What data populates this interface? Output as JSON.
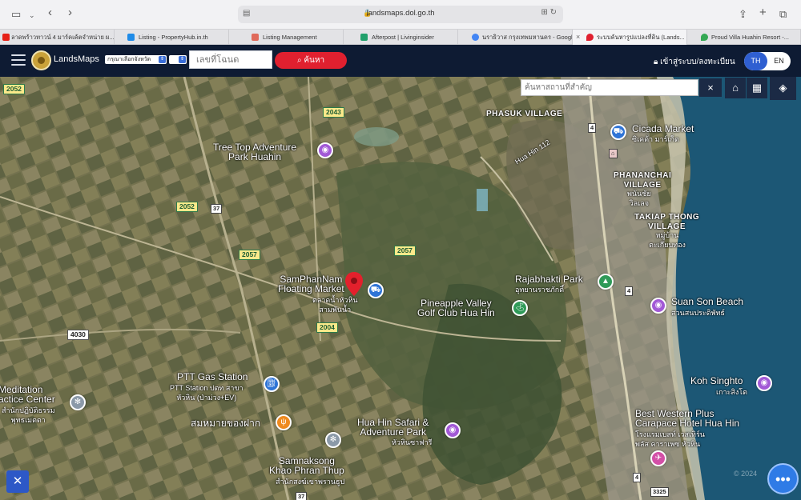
{
  "browser": {
    "url": "landsmaps.dol.go.th",
    "tabs": [
      {
        "label": "ลาดพร้าวทาวน์ 4 มาร์คเค้ตจำหน่าย ผ...",
        "color": "#e62117"
      },
      {
        "label": "Listing - PropertyHub.in.th",
        "color": "#1e8be8"
      },
      {
        "label": "Listing Management",
        "color": "#e06a5a"
      },
      {
        "label": "Afterpost | Livinginsider",
        "color": "#21a06b"
      },
      {
        "label": "นราธิวาส กรุงเทพมหานคร - Google...",
        "color": "#4285f4"
      },
      {
        "label": "ระบบค้นหารูปแปลงที่ดิน (Lands...",
        "color": "#e0202f"
      },
      {
        "label": "Proud Villa Huahin Resort -...",
        "color": "#34a853"
      }
    ]
  },
  "header": {
    "brand": "LandsMaps",
    "province_select": "กรุณาเลือกจังหวัด",
    "deed_placeholder": "เลขที่โฉนด",
    "search_label": "ค้นหา",
    "login_label": "เข้าสู่ระบบ/ลงทะเบียน",
    "lang_th": "TH",
    "lang_en": "EN"
  },
  "map": {
    "search_placeholder": "ค้นหาสถานที่สำคัญ",
    "places": [
      {
        "name": "Tree Top Adventure\nPark Huahin"
      },
      {
        "name": "PHASUK VILLAGE"
      },
      {
        "name": "Cicada Market",
        "thai": "ซิเคด้า มาร์เก็ต"
      },
      {
        "name": "PHANANCHAI\nVILLAGE",
        "thai": "พนันชัย\nวิลเลจ"
      },
      {
        "name": "TAKIAP THONG\nVILLAGE",
        "thai": "หมู่บ้าน\nตะเกียบทอง"
      },
      {
        "name": "SamPhanNam\nFloating Market",
        "thai": "ตลาดน้ำหัวหิน\nสามพันน้ำ"
      },
      {
        "name": "Rajabhakti Park",
        "thai": "อุทยานราชภักดิ์"
      },
      {
        "name": "Pineapple Valley\nGolf Club Hua Hin"
      },
      {
        "name": "Suan Son Beach",
        "thai": "สวนสนประดิพัทธ์"
      },
      {
        "name": "PTT Gas Station",
        "thai": "PTT Station ปตท สาขา\nหัวหิน (ป่าม่วง+EV)"
      },
      {
        "name": "Meditation\nactice Center",
        "thai": "สำนักปฏิบัติธรรม\nพุทธเมตตา"
      },
      {
        "name": "Koh Singhto",
        "thai": "เกาะสิงโต"
      },
      {
        "name": "สมหมายของฝาก"
      },
      {
        "name": "Hua Hin Safari &\nAdventure Park",
        "thai": "หัวหินซาฟารี"
      },
      {
        "name": "Best Western Plus\nCarapace Hotel Hua Hin",
        "thai": "โรงแรมเบสท์ เวสเทิร์น\nพลัส คาราเพซ หัวหิน"
      },
      {
        "name": "Samnaksong\nKhao Phran Thup",
        "thai": "สำนักสงฆ์เขาพรานธูป"
      }
    ],
    "roads": [
      "2052",
      "2043",
      "2052",
      "2057",
      "2057",
      "2004",
      "4030"
    ],
    "shields": [
      "37",
      "4",
      "4",
      "3325",
      "4",
      "37"
    ],
    "road_label": "Hua Hin 112",
    "watermark": "© 2024"
  }
}
